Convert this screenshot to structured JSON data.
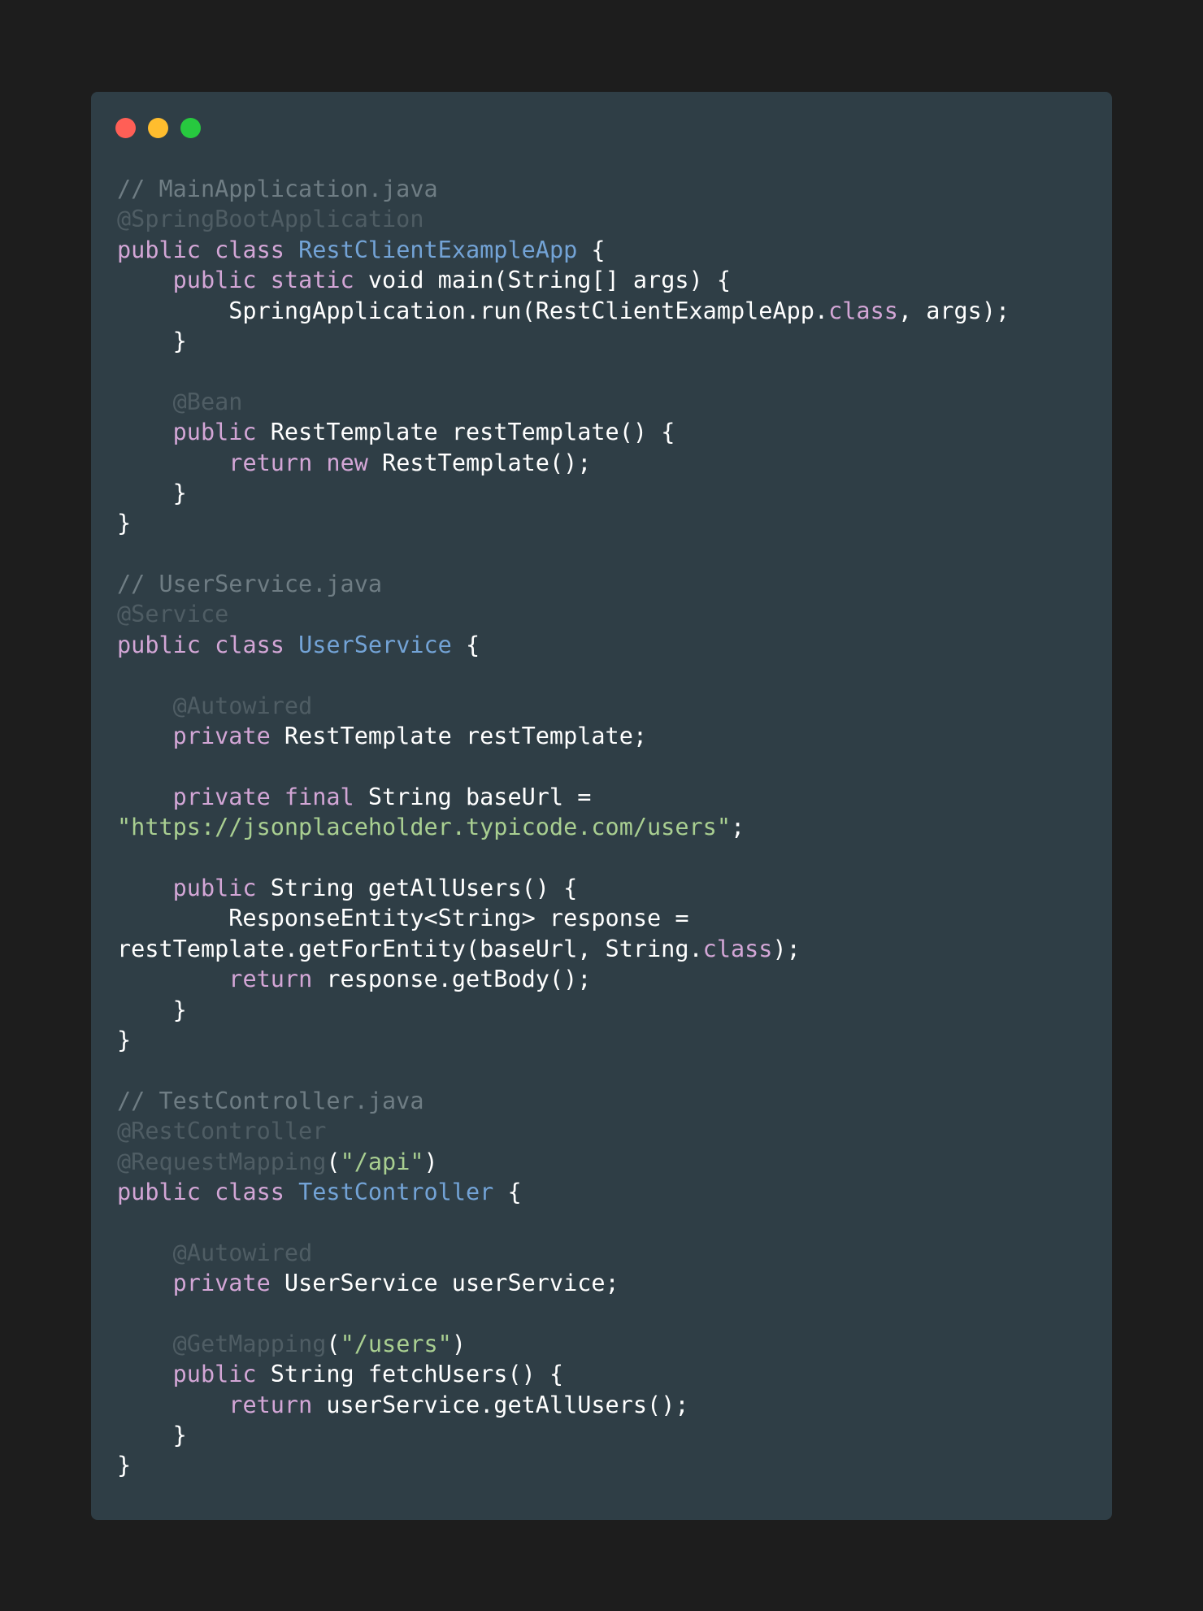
{
  "window": {
    "background": "#2f3e46",
    "page_background": "#1d1d1d",
    "traffic_lights": [
      {
        "name": "close",
        "color": "#ff5f56"
      },
      {
        "name": "minimize",
        "color": "#ffbd2e"
      },
      {
        "name": "maximize",
        "color": "#27c93f"
      }
    ]
  },
  "colors": {
    "keyword": "#d3a6d6",
    "class_name": "#73a3d6",
    "comment": "#6f7d84",
    "annotation": "#4f5d64",
    "string": "#a9cf91",
    "plain": "#ffffff"
  },
  "code": {
    "language": "java",
    "lines": [
      [
        [
          "cm",
          "// MainApplication.java"
        ]
      ],
      [
        [
          "ann",
          "@SpringBootApplication"
        ]
      ],
      [
        [
          "kw",
          "public"
        ],
        [
          "pl",
          " "
        ],
        [
          "kw",
          "class"
        ],
        [
          "pl",
          " "
        ],
        [
          "cls",
          "RestClientExampleApp"
        ],
        [
          "pl",
          " {"
        ]
      ],
      [
        [
          "pl",
          "    "
        ],
        [
          "kw",
          "public"
        ],
        [
          "pl",
          " "
        ],
        [
          "kw",
          "static"
        ],
        [
          "pl",
          " void main(String[] args) {"
        ]
      ],
      [
        [
          "pl",
          "        SpringApplication.run(RestClientExampleApp."
        ],
        [
          "kw",
          "class"
        ],
        [
          "pl",
          ", args);"
        ]
      ],
      [
        [
          "pl",
          "    }"
        ]
      ],
      [],
      [
        [
          "pl",
          "    "
        ],
        [
          "ann",
          "@Bean"
        ]
      ],
      [
        [
          "pl",
          "    "
        ],
        [
          "kw",
          "public"
        ],
        [
          "pl",
          " RestTemplate restTemplate() {"
        ]
      ],
      [
        [
          "pl",
          "        "
        ],
        [
          "kw",
          "return"
        ],
        [
          "pl",
          " "
        ],
        [
          "kw",
          "new"
        ],
        [
          "pl",
          " RestTemplate();"
        ]
      ],
      [
        [
          "pl",
          "    }"
        ]
      ],
      [
        [
          "pl",
          "}"
        ]
      ],
      [],
      [
        [
          "cm",
          "// UserService.java"
        ]
      ],
      [
        [
          "ann",
          "@Service"
        ]
      ],
      [
        [
          "kw",
          "public"
        ],
        [
          "pl",
          " "
        ],
        [
          "kw",
          "class"
        ],
        [
          "pl",
          " "
        ],
        [
          "cls",
          "UserService"
        ],
        [
          "pl",
          " {"
        ]
      ],
      [],
      [
        [
          "pl",
          "    "
        ],
        [
          "ann",
          "@Autowired"
        ]
      ],
      [
        [
          "pl",
          "    "
        ],
        [
          "kw",
          "private"
        ],
        [
          "pl",
          " RestTemplate restTemplate;"
        ]
      ],
      [],
      [
        [
          "pl",
          "    "
        ],
        [
          "kw",
          "private"
        ],
        [
          "pl",
          " "
        ],
        [
          "kw",
          "final"
        ],
        [
          "pl",
          " String baseUrl ="
        ]
      ],
      [
        [
          "str",
          "\"https://jsonplaceholder.typicode.com/users\""
        ],
        [
          "pl",
          ";"
        ]
      ],
      [],
      [
        [
          "pl",
          "    "
        ],
        [
          "kw",
          "public"
        ],
        [
          "pl",
          " String getAllUsers() {"
        ]
      ],
      [
        [
          "pl",
          "        ResponseEntity<String> response ="
        ]
      ],
      [
        [
          "pl",
          "restTemplate.getForEntity(baseUrl, String."
        ],
        [
          "kw",
          "class"
        ],
        [
          "pl",
          ");"
        ]
      ],
      [
        [
          "pl",
          "        "
        ],
        [
          "kw",
          "return"
        ],
        [
          "pl",
          " response.getBody();"
        ]
      ],
      [
        [
          "pl",
          "    }"
        ]
      ],
      [
        [
          "pl",
          "}"
        ]
      ],
      [],
      [
        [
          "cm",
          "// TestController.java"
        ]
      ],
      [
        [
          "ann",
          "@RestController"
        ]
      ],
      [
        [
          "ann",
          "@RequestMapping"
        ],
        [
          "pl",
          "("
        ],
        [
          "str",
          "\"/api\""
        ],
        [
          "pl",
          ")"
        ]
      ],
      [
        [
          "kw",
          "public"
        ],
        [
          "pl",
          " "
        ],
        [
          "kw",
          "class"
        ],
        [
          "pl",
          " "
        ],
        [
          "cls",
          "TestController"
        ],
        [
          "pl",
          " {"
        ]
      ],
      [],
      [
        [
          "pl",
          "    "
        ],
        [
          "ann",
          "@Autowired"
        ]
      ],
      [
        [
          "pl",
          "    "
        ],
        [
          "kw",
          "private"
        ],
        [
          "pl",
          " UserService userService;"
        ]
      ],
      [],
      [
        [
          "pl",
          "    "
        ],
        [
          "ann",
          "@GetMapping"
        ],
        [
          "pl",
          "("
        ],
        [
          "str",
          "\"/users\""
        ],
        [
          "pl",
          ")"
        ]
      ],
      [
        [
          "pl",
          "    "
        ],
        [
          "kw",
          "public"
        ],
        [
          "pl",
          " String fetchUsers() {"
        ]
      ],
      [
        [
          "pl",
          "        "
        ],
        [
          "kw",
          "return"
        ],
        [
          "pl",
          " userService.getAllUsers();"
        ]
      ],
      [
        [
          "pl",
          "    }"
        ]
      ],
      [
        [
          "pl",
          "}"
        ]
      ]
    ]
  }
}
